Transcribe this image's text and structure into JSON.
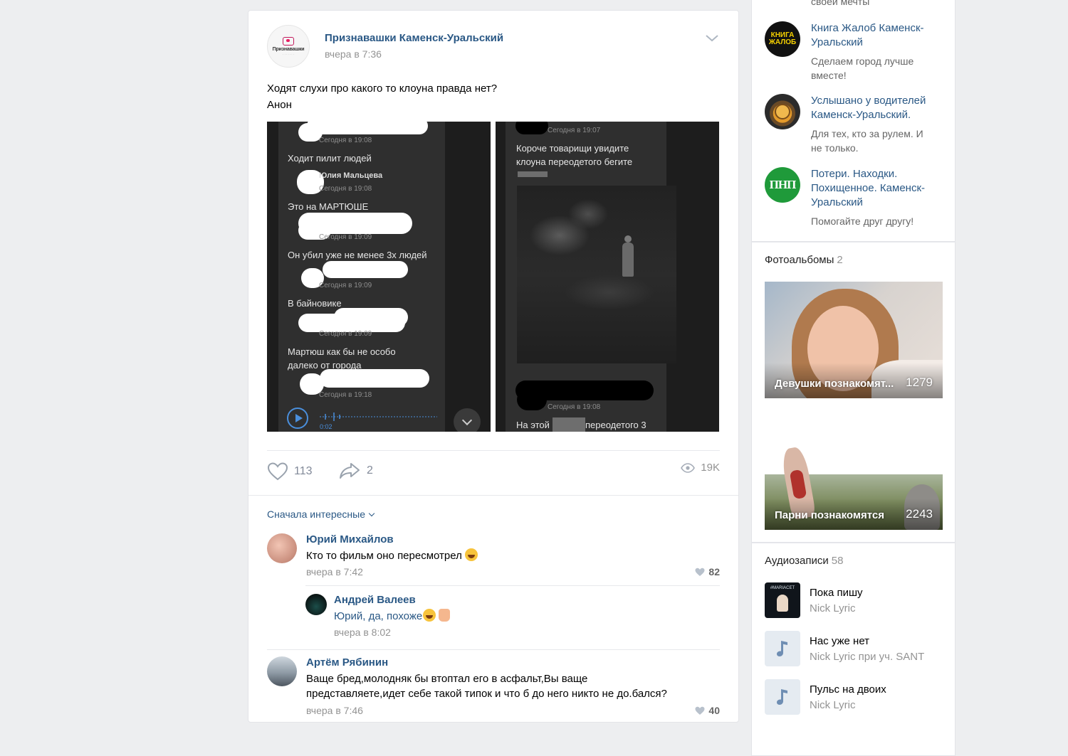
{
  "post": {
    "group_name": "Признавашки Каменск-Уральский",
    "group_avatar_title": "Признавашки",
    "time": "вчера в 7:36",
    "text_lines": [
      "Ходят слухи про какого то клоуна правда нет?",
      "Анон"
    ],
    "screenshot1": {
      "lines": [
        {
          "kind": "meta",
          "text": "Сегодня в 19:08"
        },
        {
          "kind": "msg",
          "text": "Ходит пилит людей"
        },
        {
          "kind": "name",
          "text": "Юлия Мальцева"
        },
        {
          "kind": "meta",
          "text": "Сегодня в 19:08"
        },
        {
          "kind": "msg",
          "text": "Это на МАРТЮШЕ"
        },
        {
          "kind": "meta",
          "text": "Сегодня в 19:09"
        },
        {
          "kind": "msg",
          "text": "Он убил уже не менее 3х людей"
        },
        {
          "kind": "meta",
          "text": "Сегодня в 19:09"
        },
        {
          "kind": "msg",
          "text": "В байновике"
        },
        {
          "kind": "meta",
          "text": "Сегодня в 19:09"
        },
        {
          "kind": "msg",
          "text": "Мартюш как бы не особо"
        },
        {
          "kind": "msg",
          "text": "далеко от города"
        },
        {
          "kind": "meta",
          "text": "Сегодня в 19:18"
        }
      ],
      "audio_time": "0:02"
    },
    "screenshot2": {
      "top_meta": "Сегодня в 19:07",
      "msg_line1": "Короче товарищи увидите",
      "msg_line2": "клоуна переодетого бегите",
      "bottom_meta": "Сегодня в 19:08",
      "bottom_msg_left": "На этой",
      "bottom_msg_right": "переодетого 3"
    },
    "likes": "113",
    "shares": "2",
    "views": "19K"
  },
  "comments": {
    "sort_label": "Сначала интересные",
    "items": [
      {
        "name": "Юрий Михайлов",
        "text": "Кто то фильм оно пересмотрел",
        "time": "вчера в 7:42",
        "likes": "82"
      },
      {
        "name": "Андрей Валеев",
        "text": "Юрий, да, похоже",
        "time": "вчера в 8:02"
      },
      {
        "name": "Артём Рябинин",
        "text_line1": "Ваще бред,молодняк бы втоптал его в асфальт,Вы ваще",
        "text_line2": "представляете,идет себе такой типок и что б до него никто не до.бался?",
        "time": "вчера в 7:46",
        "likes": "40"
      }
    ]
  },
  "sidebar": {
    "top_cut_text": "своей мечты",
    "groups": [
      {
        "title_line1": "Книга Жалоб Каменск-",
        "title_line2": "Уральский",
        "desc_line1": "Сделаем город лучше",
        "desc_line2": "вместе!",
        "avatar_text_line1": "КНИГА",
        "avatar_text_line2": "ЖАЛОБ"
      },
      {
        "title_line1": "Услышано у водителей",
        "title_line2": "Каменск-Уральский.",
        "desc_line1": "Для тех, кто за рулем. И",
        "desc_line2": "не только."
      },
      {
        "title_line1": "Потери. Находки.",
        "title_line2": "Похищенное. Каменск-",
        "title_line3": "Уральский",
        "desc_line1": "Помогайте друг другу!",
        "avatar_text": "ПНП"
      }
    ],
    "albums_header": "Фотоальбомы",
    "albums_count": "2",
    "albums": [
      {
        "label": "Девушки познакомят...",
        "count": "1279"
      },
      {
        "label": "Парни познакомятся",
        "count": "2243"
      }
    ],
    "audio_header": "Аудиозаписи",
    "audio_count": "58",
    "tracks": [
      {
        "title": "Пока пишу",
        "artist": "Nick Lyric",
        "cover_text": "#MARIACET"
      },
      {
        "title": "Нас уже нет",
        "artist": "Nick Lyric при уч. SANT"
      },
      {
        "title": "Пульс на двоих",
        "artist": "Nick Lyric"
      }
    ]
  },
  "colors": {
    "link": "#2a5885",
    "page_bg": "#edeef0",
    "muted": "#939393"
  }
}
